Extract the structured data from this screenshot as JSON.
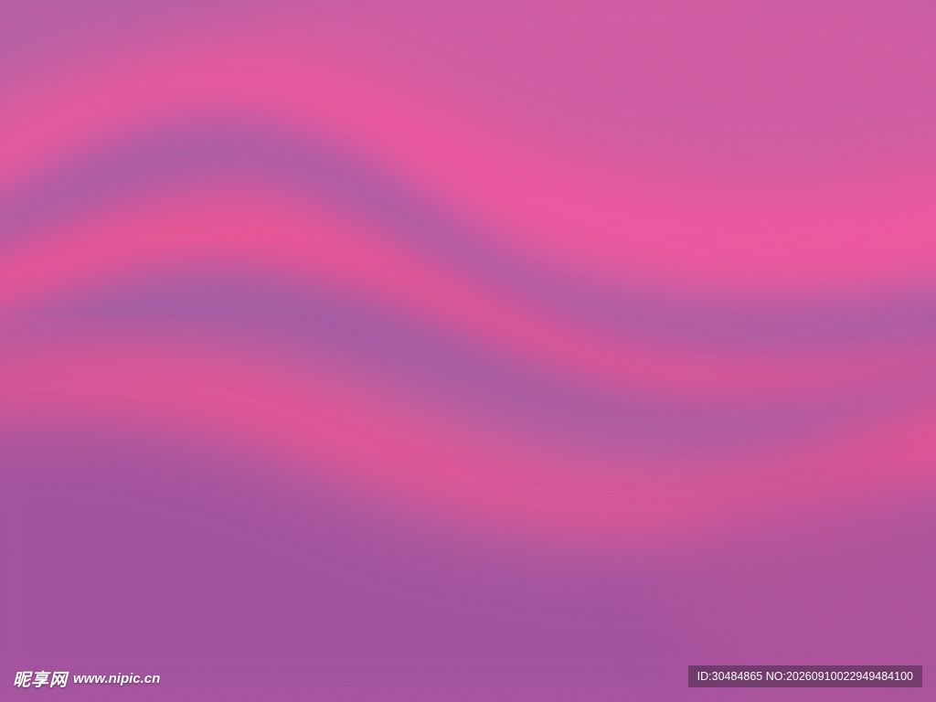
{
  "image": {
    "subject": "abstract pink and purple wave gradient",
    "colors": {
      "background": "#b05a9c",
      "pink_band": "#f0508e",
      "purple_band": "#9a589f",
      "deep_purple": "#9b4e98"
    }
  },
  "watermark": {
    "brand_text": "昵享网",
    "url_text": "www.nipic.cn",
    "id_text": "ID:30484865 NO:20260910022949484100"
  }
}
